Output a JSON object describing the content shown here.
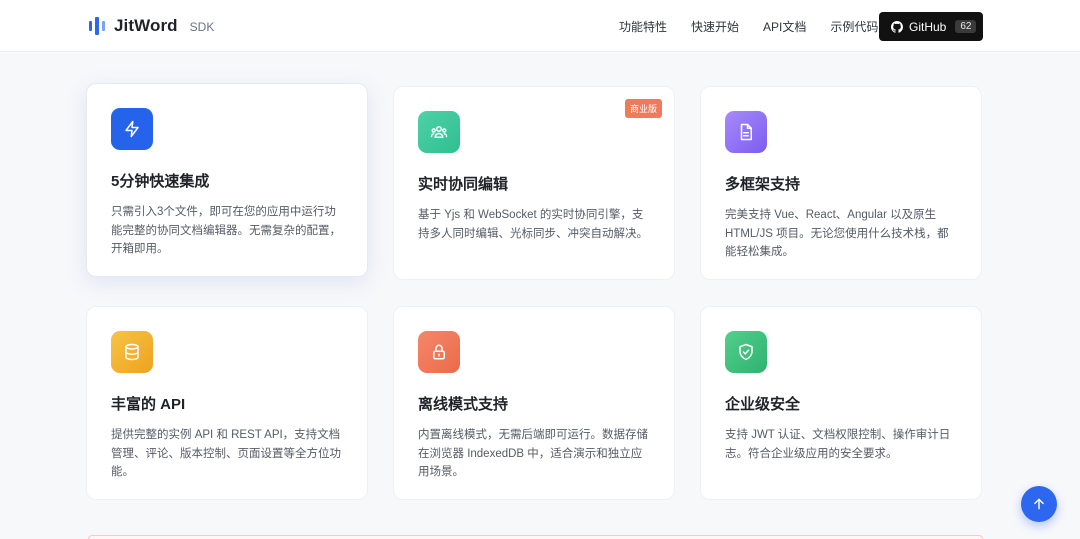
{
  "header": {
    "brand": "JitWord",
    "tag": "SDK",
    "nav": [
      "功能特性",
      "快速开始",
      "API文档",
      "示例代码"
    ],
    "github_label": "GitHub",
    "github_count": "62"
  },
  "features": [
    {
      "title": "5分钟快速集成",
      "desc": "只需引入3个文件，即可在您的应用中运行功能完整的协同文档编辑器。无需复杂的配置，开箱即用。",
      "icon": "lightning-icon",
      "color": "#2563eb"
    },
    {
      "title": "实时协同编辑",
      "desc": "基于 Yjs 和 WebSocket 的实时协同引擎，支持多人同时编辑、光标同步、冲突自动解决。",
      "icon": "users-icon",
      "color": "#34c79a",
      "badge": "商业版"
    },
    {
      "title": "多框架支持",
      "desc": "完美支持 Vue、React、Angular 以及原生HTML/JS 项目。无论您使用什么技术栈，都能轻松集成。",
      "icon": "document-icon",
      "color": "#8b5cf6"
    },
    {
      "title": "丰富的 API",
      "desc": "提供完整的实例 API 和 REST API，支持文档管理、评论、版本控制、页面设置等全方位功能。",
      "icon": "database-icon",
      "color": "#f0b429"
    },
    {
      "title": "离线模式支持",
      "desc": "内置离线模式，无需后端即可运行。数据存储在浏览器 IndexedDB 中，适合演示和独立应用场景。",
      "icon": "lock-icon",
      "color": "#f07a55"
    },
    {
      "title": "企业级安全",
      "desc": "支持 JWT 认证、文档权限控制、操作审计日志。符合企业级应用的安全要求。",
      "icon": "shield-check-icon",
      "color": "#3dbf7c"
    }
  ],
  "colors": {
    "primary": "#2d67f0",
    "badge": "#ef7b5c"
  }
}
